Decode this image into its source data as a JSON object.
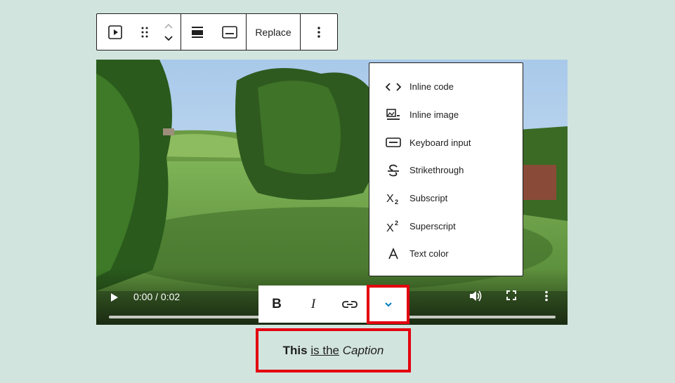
{
  "block_toolbar": {
    "replace_label": "Replace",
    "icons": [
      "video-block-icon",
      "drag-handle-icon",
      "move-up-icon",
      "move-down-icon",
      "align-icon",
      "caption-icon",
      "more-options-icon"
    ]
  },
  "video": {
    "time": "0:00 / 0:02",
    "progress_fraction": 0.0
  },
  "dropdown": {
    "items": [
      {
        "label": "Inline code",
        "icon": "code-icon"
      },
      {
        "label": "Inline image",
        "icon": "inline-image-icon"
      },
      {
        "label": "Keyboard input",
        "icon": "keyboard-icon"
      },
      {
        "label": "Strikethrough",
        "icon": "strikethrough-icon"
      },
      {
        "label": "Subscript",
        "icon": "subscript-icon"
      },
      {
        "label": "Superscript",
        "icon": "superscript-icon"
      },
      {
        "label": "Text color",
        "icon": "text-color-icon"
      }
    ]
  },
  "format_toolbar": {
    "bold": "B",
    "italic": "I"
  },
  "caption": {
    "part1": "This",
    "part2": "is the",
    "part3": "Caption"
  },
  "colors": {
    "background": "#d2e4de",
    "highlight": "#e3000f",
    "accent": "#007cba"
  }
}
